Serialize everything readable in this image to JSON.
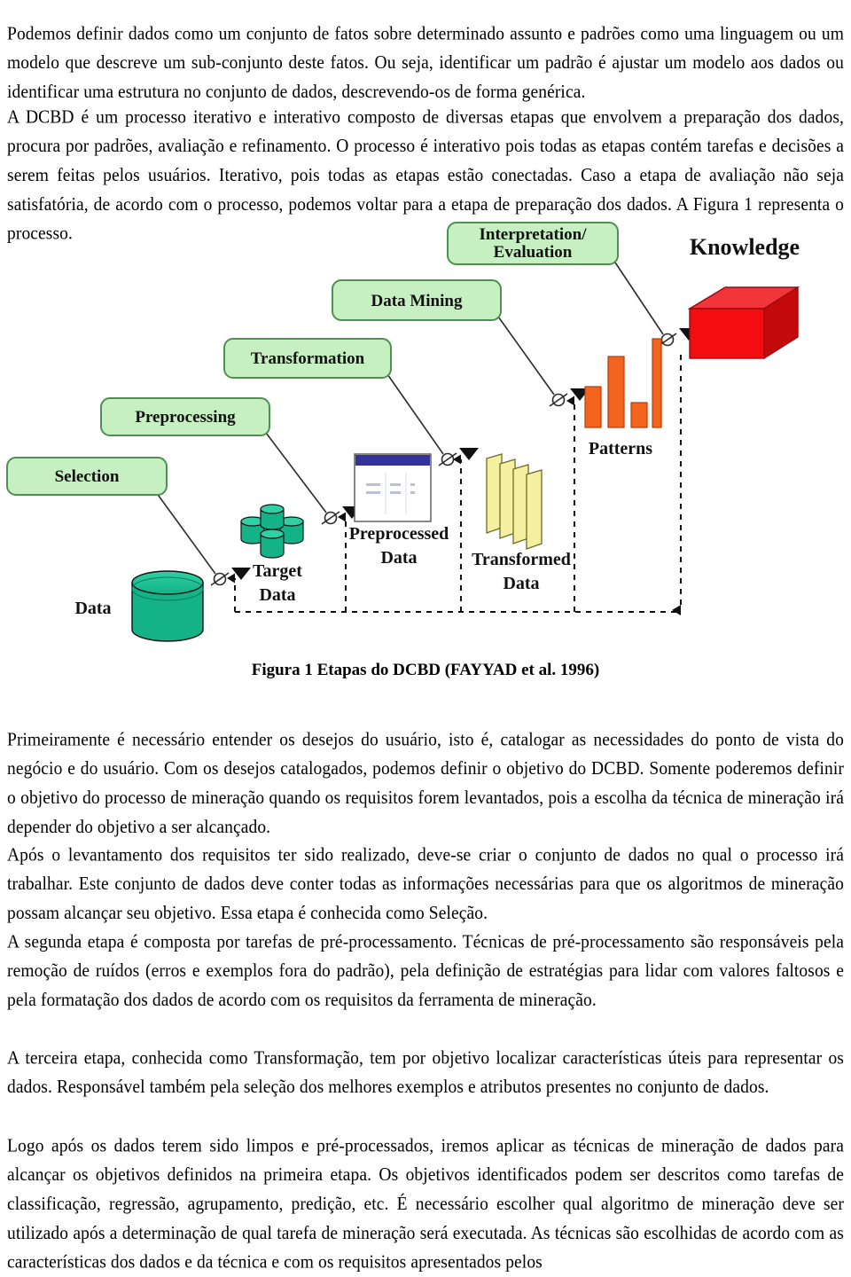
{
  "document": {
    "paragraphs": [
      "Podemos definir dados como um conjunto de fatos sobre determinado assunto e padrões como uma linguagem ou um modelo que descreve um sub-conjunto deste fatos. Ou seja, identificar um padrão é ajustar um modelo aos dados ou identificar uma estrutura no conjunto de dados, descrevendo-os de forma genérica.",
      "A DCBD é um processo iterativo e interativo composto de diversas etapas que envolvem a preparação dos dados, procura por padrões, avaliação e refinamento. O processo é interativo pois todas as etapas contém tarefas e decisões a serem feitas pelos usuários. Iterativo, pois todas as etapas estão conectadas. Caso a etapa de avaliação não seja satisfatória, de acordo com o processo, podemos voltar para a etapa de preparação dos dados. A Figura 1 representa o processo.",
      "Primeiramente é necessário entender os desejos do usuário, isto é, catalogar as necessidades do ponto de vista do negócio e do usuário. Com os desejos catalogados, podemos definir o objetivo do DCBD. Somente poderemos definir o objetivo do processo de mineração quando os requisitos forem levantados, pois a escolha da  técnica de mineração irá depender do objetivo a ser alcançado.",
      "Após o levantamento dos requisitos ter sido realizado, deve-se criar o conjunto de dados no qual o processo irá trabalhar. Este conjunto de dados deve conter todas as informações necessárias para que os algoritmos de mineração possam alcançar seu objetivo. Essa etapa é conhecida como Seleção.",
      "A segunda etapa é composta por tarefas de pré-processamento. Técnicas de pré-processamento são responsáveis pela remoção de ruídos (erros e exemplos fora do padrão), pela definição de estratégias para lidar com valores faltosos e pela formatação dos dados de acordo com os requisitos da ferramenta de mineração.",
      "A terceira etapa, conhecida como Transformação, tem por objetivo localizar características úteis para representar os dados. Responsável também pela seleção dos melhores exemplos e atributos presentes no conjunto de dados.",
      "Logo após os dados terem sido limpos e pré-processados, iremos aplicar as técnicas de mineração de dados para alcançar os objetivos definidos na primeira etapa. Os objetivos identificados podem ser descritos como tarefas de classificação, regressão, agrupamento, predição, etc. É necessário escolher qual algoritmo de mineração deve ser utilizado após a determinação de qual tarefa de mineração será executada. As técnicas são escolhidas de acordo com as características dos dados e da técnica e com os requisitos apresentados pelos"
    ]
  },
  "figure": {
    "caption": "Figura 1 Etapas do DCBD (FAYYAD et al. 1996)",
    "stage_boxes": [
      {
        "label": "Selection"
      },
      {
        "label": "Preprocessing"
      },
      {
        "label": "Transformation"
      },
      {
        "label": "Data Mining"
      },
      {
        "label_line1": "Interpretation/",
        "label_line2": "Evaluation"
      }
    ],
    "artifacts": [
      {
        "label": "Data"
      },
      {
        "label_line1": "Target",
        "label_line2": "Data"
      },
      {
        "label_line1": "Preprocessed",
        "label_line2": "Data"
      },
      {
        "label_line1": "Transformed",
        "label_line2": "Data"
      },
      {
        "label": "Patterns"
      },
      {
        "label": "Knowledge"
      }
    ],
    "colors": {
      "stage_box_fill": "#c6f0c2",
      "stage_box_stroke": "#4f8f52",
      "data_cylinder": "#13b387",
      "transformed_sheet": "#f5f0a0",
      "patterns_bar": "#f2641e",
      "knowledge_cube": "#f40d10",
      "table_header": "#33339a",
      "connector": "#2b2b2b"
    },
    "patterns_bars": [
      46,
      80,
      28,
      100
    ]
  }
}
